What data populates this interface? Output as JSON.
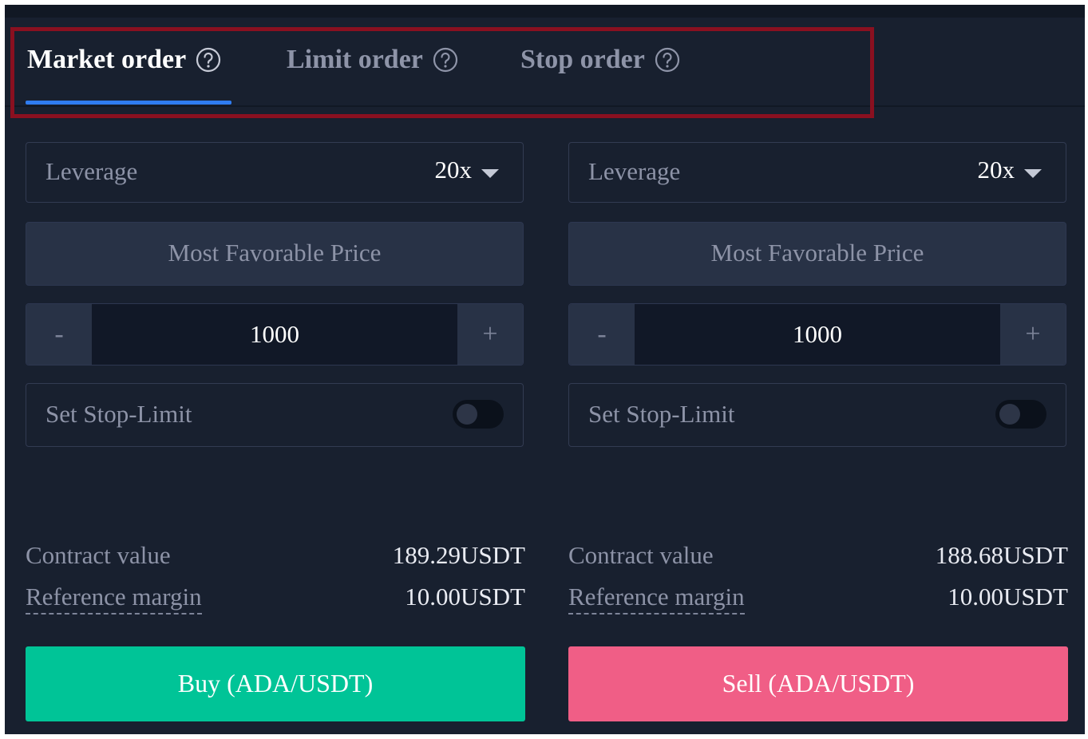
{
  "tabs": [
    {
      "label": "Market order",
      "active": true
    },
    {
      "label": "Limit order",
      "active": false
    },
    {
      "label": "Stop order",
      "active": false
    }
  ],
  "colors": {
    "background": "#18202f",
    "tab_active": "#ffffff",
    "tab_underline": "#2f7cf0",
    "highlight_box": "#8a1020",
    "buy": "#00c497",
    "sell": "#f05e86"
  },
  "buy_panel": {
    "leverage_label": "Leverage",
    "leverage_value": "20x",
    "price_button": "Most Favorable Price",
    "minus_label": "-",
    "quantity": "1000",
    "plus_label": "+",
    "stop_limit_label": "Set Stop-Limit",
    "stop_limit_enabled": false,
    "contract_value_label": "Contract value",
    "contract_value": "189.29USDT",
    "reference_margin_label": "Reference margin",
    "reference_margin": "10.00USDT",
    "action_label": "Buy (ADA/USDT)"
  },
  "sell_panel": {
    "leverage_label": "Leverage",
    "leverage_value": "20x",
    "price_button": "Most Favorable Price",
    "minus_label": "-",
    "quantity": "1000",
    "plus_label": "+",
    "stop_limit_label": "Set Stop-Limit",
    "stop_limit_enabled": false,
    "contract_value_label": "Contract value",
    "contract_value": "188.68USDT",
    "reference_margin_label": "Reference margin",
    "reference_margin": "10.00USDT",
    "action_label": "Sell (ADA/USDT)"
  }
}
